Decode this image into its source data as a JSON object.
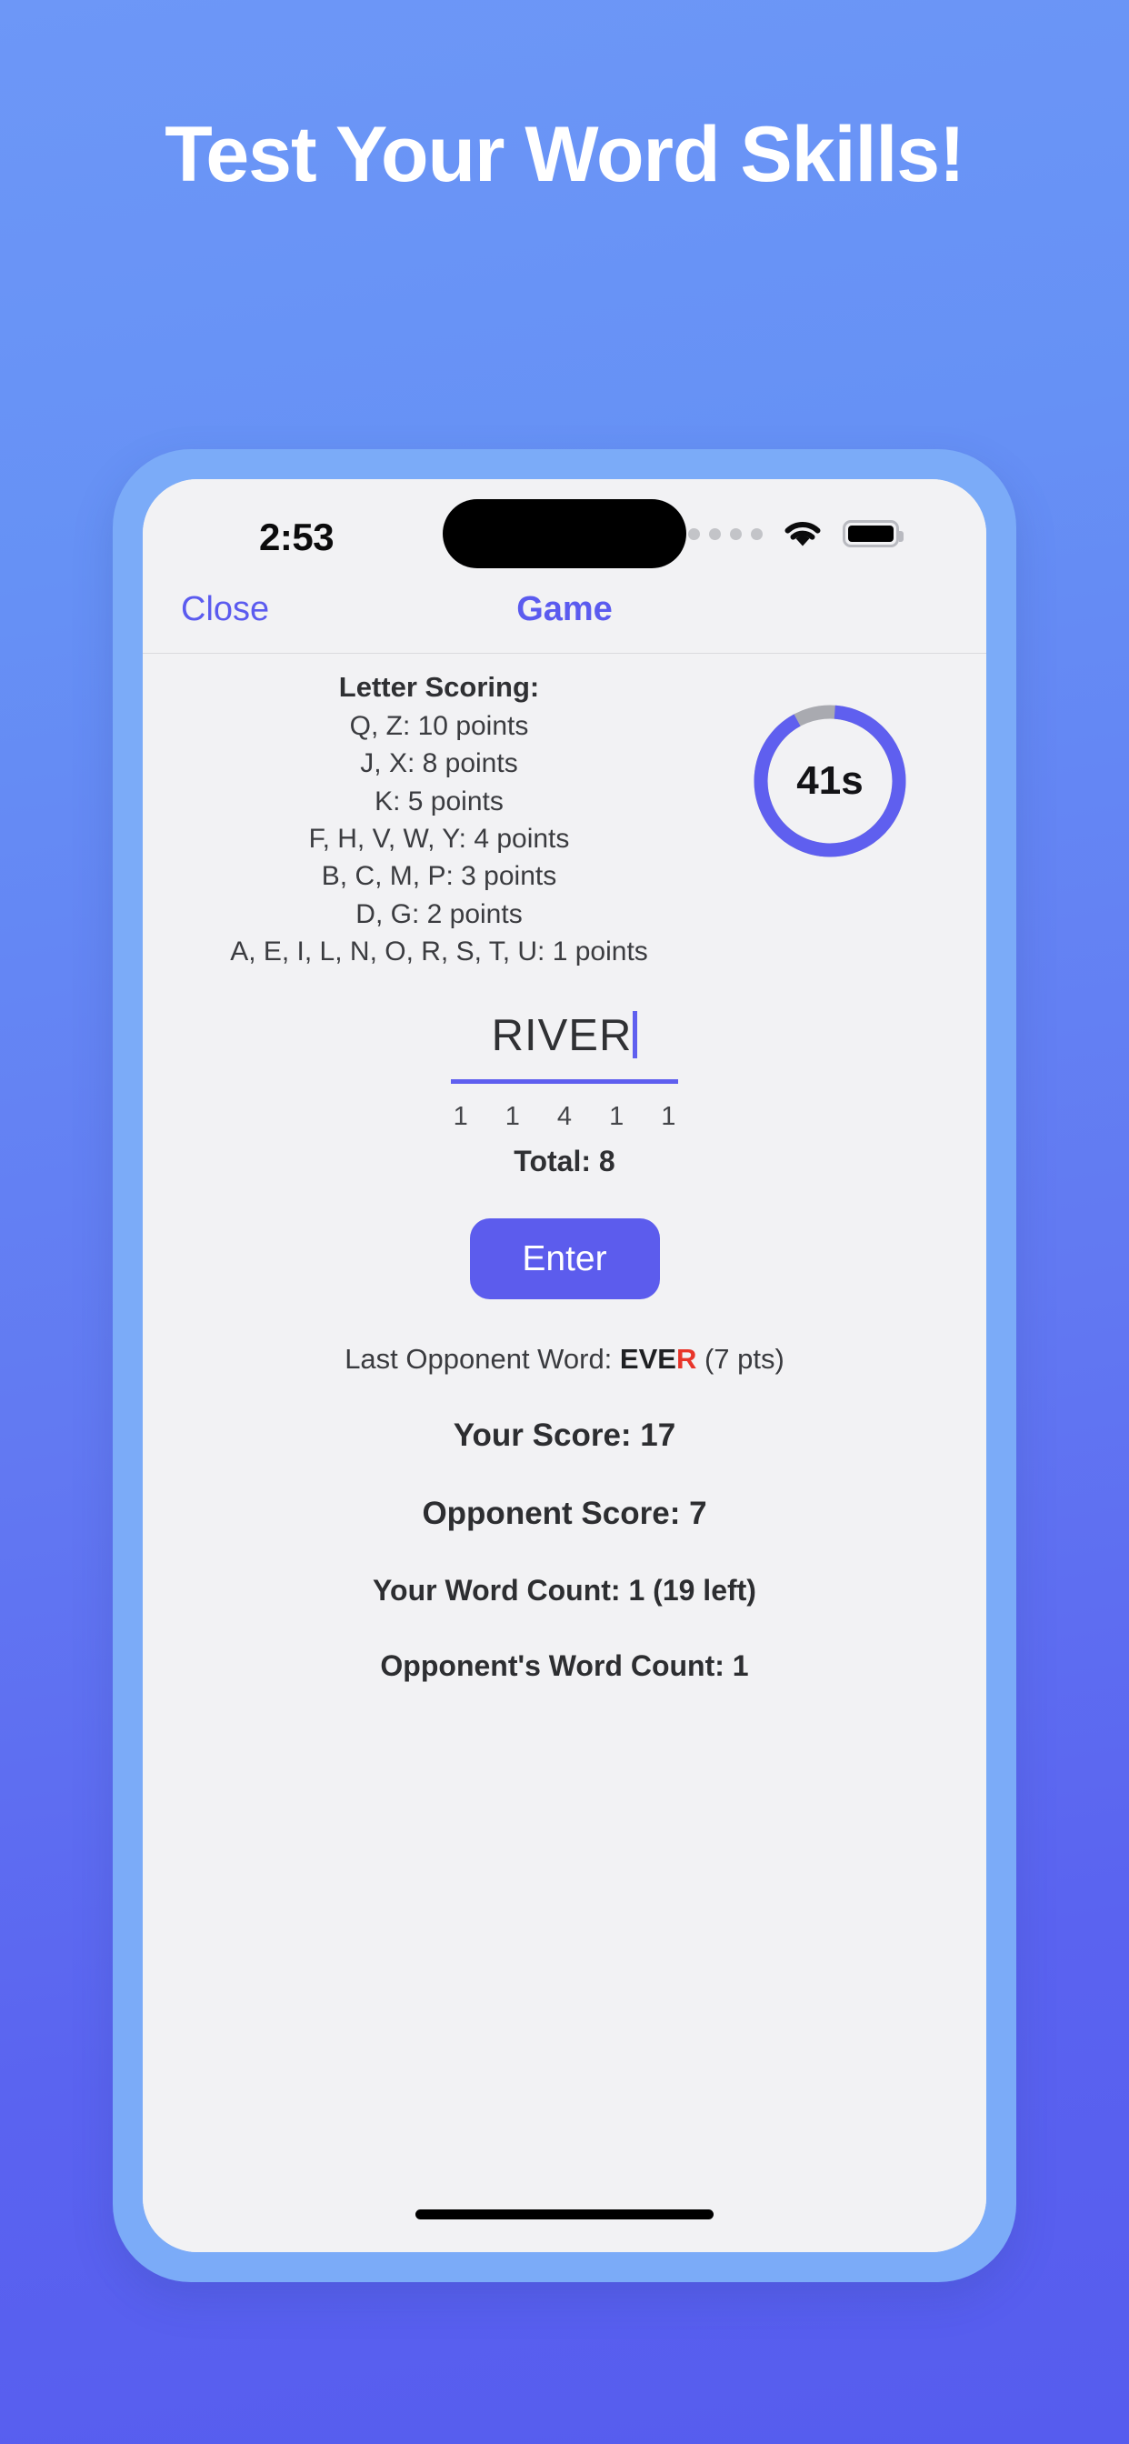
{
  "promo": {
    "headline": "Test Your Word Skills!"
  },
  "status_bar": {
    "time": "2:53",
    "cellular_icon": "signal-dots-icon",
    "wifi_icon": "wifi-icon",
    "battery_icon": "battery-full-icon"
  },
  "navbar": {
    "close_label": "Close",
    "title": "Game"
  },
  "scoring": {
    "heading": "Letter Scoring:",
    "lines": [
      "Q, Z: 10 points",
      "J, X: 8 points",
      "K: 5 points",
      "F, H, V, W, Y: 4 points",
      "B, C, M, P: 3 points",
      "D, G: 2 points",
      "A, E, I, L, N, O, R, S, T, U: 1 points"
    ]
  },
  "timer": {
    "label": "41s",
    "seconds_remaining": 41,
    "total_seconds": 45,
    "progress_percent": 91,
    "track_color": "#a9aab0",
    "fill_color": "#5f5fef"
  },
  "word_entry": {
    "value": "RIVER",
    "placeholder": "",
    "letter_points": [
      "1",
      "1",
      "4",
      "1",
      "1"
    ],
    "total_label": "Total: 8",
    "submit_label": "Enter",
    "accent_color": "#5c5ced"
  },
  "stats": {
    "last_opponent_prefix": "Last Opponent Word: ",
    "last_opponent_word_good": "EVE",
    "last_opponent_word_bad": "R",
    "last_opponent_suffix": " (7 pts)",
    "your_score": "Your Score: 17",
    "opponent_score": "Opponent Score: 7",
    "your_word_count": "Your Word Count: 1 (19 left)",
    "opponent_word_count": "Opponent's Word Count: 1"
  }
}
